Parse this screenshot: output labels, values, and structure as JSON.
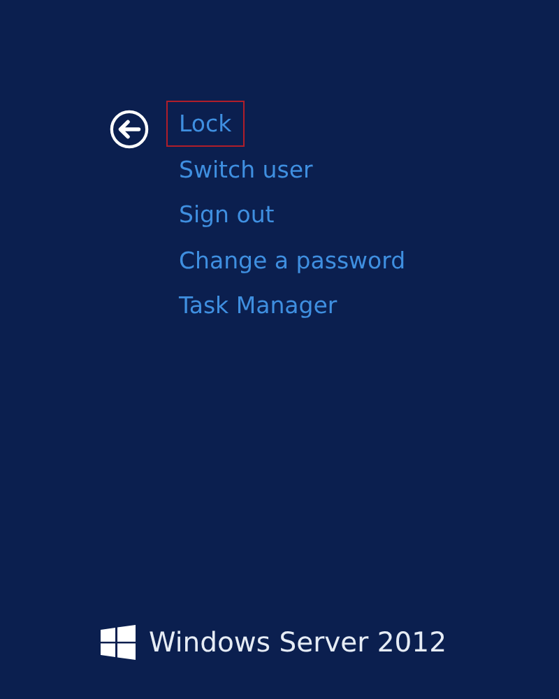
{
  "menu": {
    "items": [
      {
        "label": "Lock",
        "selected": true
      },
      {
        "label": "Switch user",
        "selected": false
      },
      {
        "label": "Sign out",
        "selected": false
      },
      {
        "label": "Change a password",
        "selected": false
      },
      {
        "label": "Task Manager",
        "selected": false
      }
    ]
  },
  "footer": {
    "brand": "Windows Server 2012"
  }
}
